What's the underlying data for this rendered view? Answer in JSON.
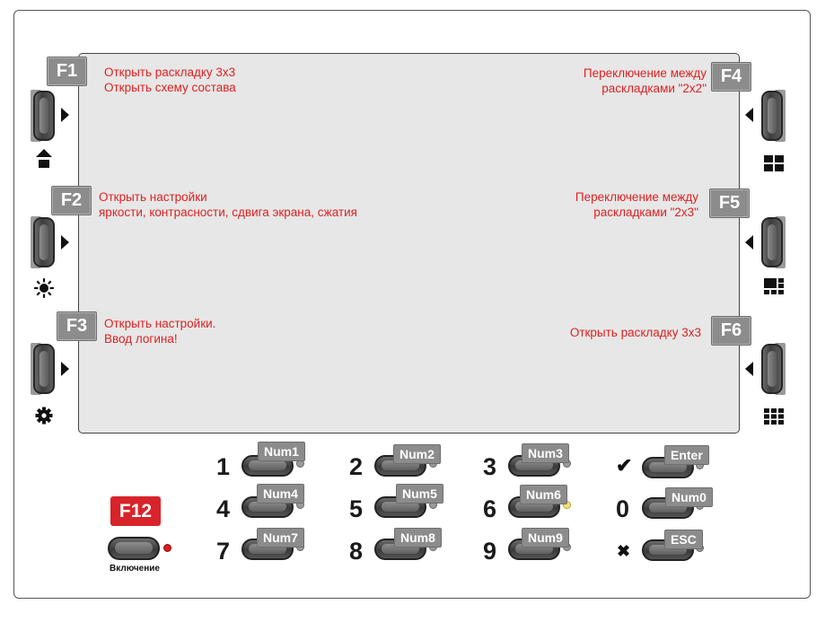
{
  "function_keys": {
    "f1": {
      "label": "F1",
      "lines": [
        "Открыть раскладку 3x3",
        "Открыть схему состава"
      ]
    },
    "f2": {
      "label": "F2",
      "lines": [
        "Открыть настройки",
        "яркости, контрасности, сдвига экрана, сжатия"
      ]
    },
    "f3": {
      "label": "F3",
      "lines": [
        "Открыть настройки.",
        "Ввод логина!"
      ]
    },
    "f4": {
      "label": "F4",
      "lines": [
        "Переключение между",
        "раскладками \"2x2\""
      ]
    },
    "f5": {
      "label": "F5",
      "lines": [
        "Переключение между",
        "раскладками \"2x3\""
      ]
    },
    "f6": {
      "label": "F6",
      "lines": [
        "Открыть раскладку 3x3"
      ]
    }
  },
  "side_icons": {
    "left": [
      "home-icon",
      "brightness-icon",
      "settings-gear-icon"
    ],
    "right": [
      "grid-2x2-icon",
      "grid-2x3-icon",
      "grid-3x3-icon"
    ]
  },
  "keypad": {
    "keys": [
      {
        "digit": "1",
        "tag": "Num1"
      },
      {
        "digit": "2",
        "tag": "Num2"
      },
      {
        "digit": "3",
        "tag": "Num3"
      },
      {
        "digit": "4",
        "tag": "Num4"
      },
      {
        "digit": "5",
        "tag": "Num5"
      },
      {
        "digit": "6",
        "tag": "Num6"
      },
      {
        "digit": "7",
        "tag": "Num7"
      },
      {
        "digit": "8",
        "tag": "Num8"
      },
      {
        "digit": "9",
        "tag": "Num9"
      },
      {
        "digit": "0",
        "tag": "Num0"
      }
    ],
    "enter": {
      "tag": "Enter",
      "glyph": "✔"
    },
    "esc": {
      "tag": "ESC",
      "glyph": "✖"
    }
  },
  "power": {
    "key": "F12",
    "label": "Включение"
  },
  "colors": {
    "accent_red": "#d8232a",
    "label_red": "#e02020",
    "tag_gray": "#8c8c8c",
    "led_yellow": "#f5e27a"
  }
}
